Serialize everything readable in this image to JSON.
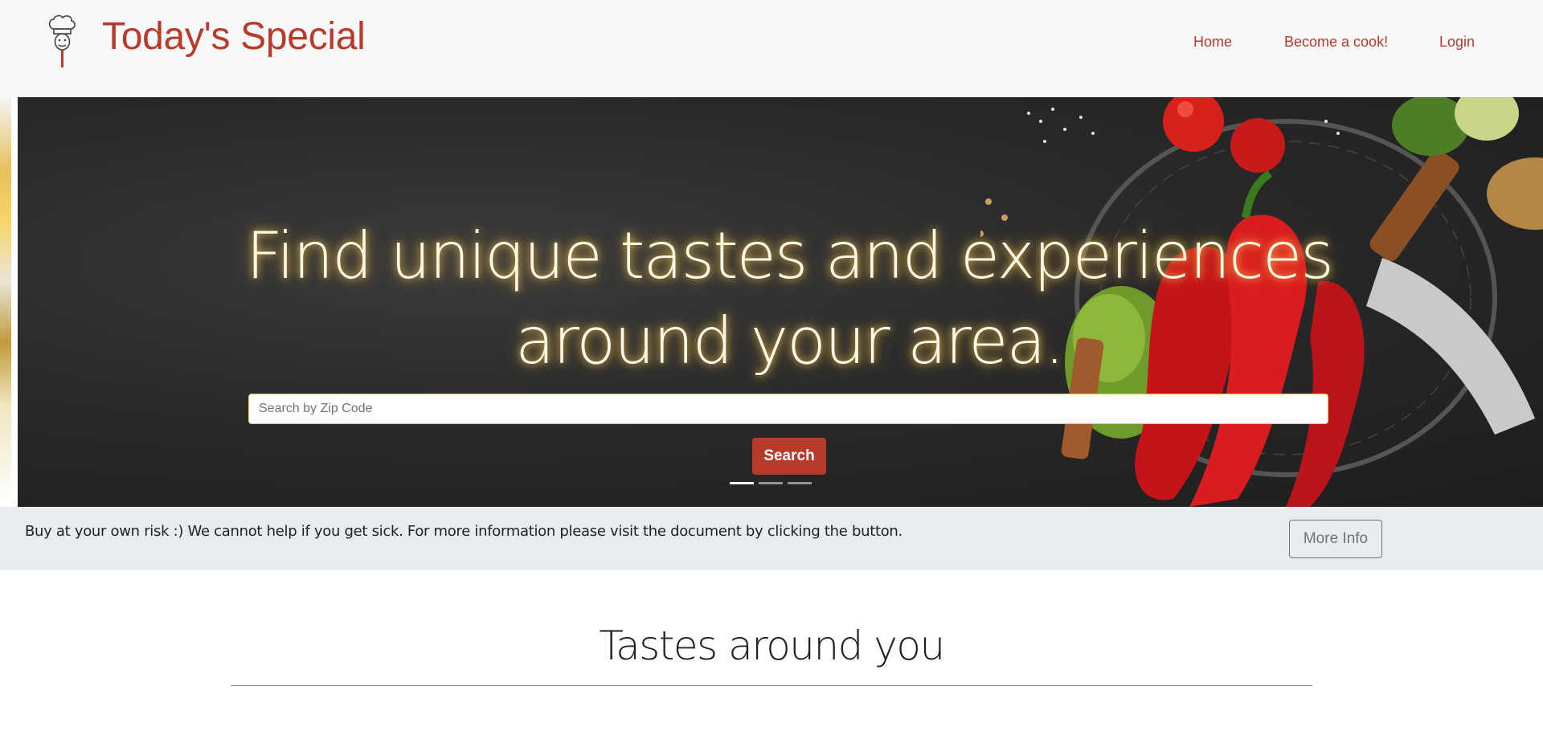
{
  "brand": {
    "name": "Today's Special",
    "logo_icon": "chef-hat-icon"
  },
  "nav": {
    "items": [
      {
        "label": "Home"
      },
      {
        "label": "Become a cook!"
      },
      {
        "label": "Login"
      }
    ]
  },
  "hero": {
    "title_line1": "Find unique tastes and experiences",
    "title_line2": "around your area.",
    "search_placeholder": "Search by Zip Code",
    "search_value": "",
    "search_button_label": "Search",
    "slides_count": 3,
    "active_slide": 1
  },
  "disclaimer": {
    "text": "Buy at your own risk :) We cannot help if you get sick. For more information please visit the document by clicking the button.",
    "button_label": "More Info"
  },
  "section": {
    "title": "Tastes around you"
  },
  "colors": {
    "brand": "#b83a2a",
    "navbar_bg": "#f7f8fa",
    "disclaimer_bg": "#e9ecef",
    "outline_button": "#6c757d"
  }
}
